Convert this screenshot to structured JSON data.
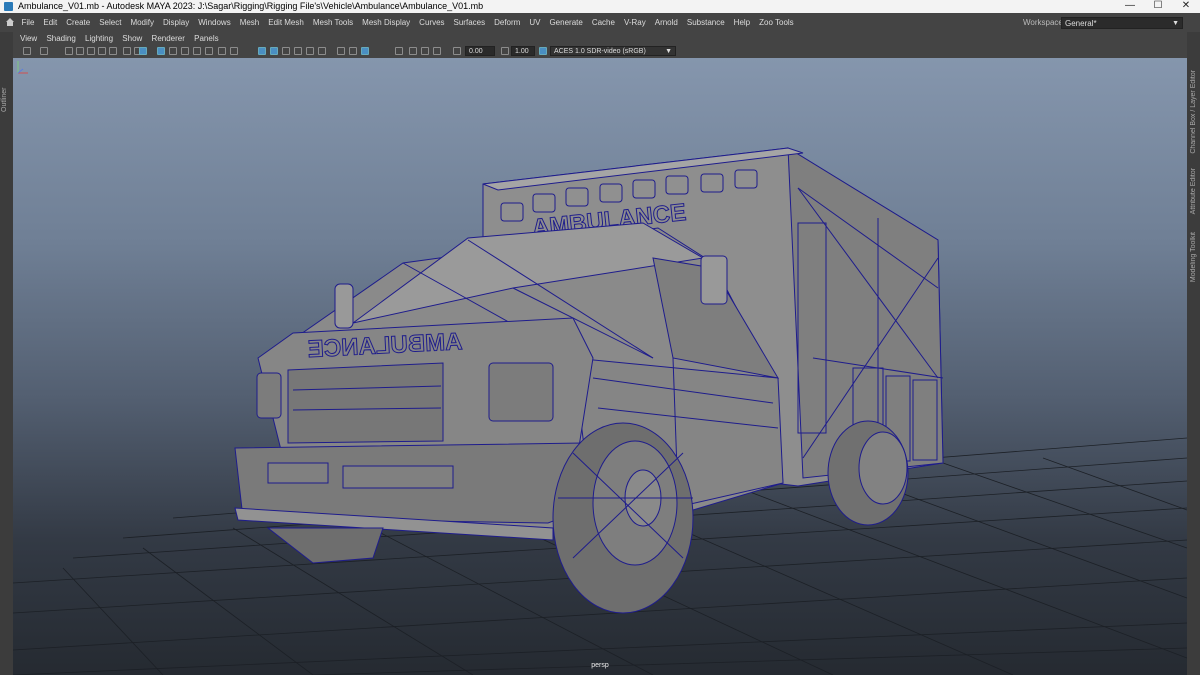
{
  "window": {
    "title": "Ambulance_V01.mb - Autodesk MAYA 2023: J:\\Sagar\\Rigging\\Rigging File's\\Vehicle\\Ambulance\\Ambulance_V01.mb",
    "minimize": "—",
    "maximize": "☐",
    "close": "✕"
  },
  "menubar": {
    "items": [
      "File",
      "Edit",
      "Create",
      "Select",
      "Modify",
      "Display",
      "Windows",
      "Mesh",
      "Edit Mesh",
      "Mesh Tools",
      "Mesh Display",
      "Curves",
      "Surfaces",
      "Deform",
      "UV",
      "Generate",
      "Cache",
      "V-Ray",
      "Arnold",
      "Substance",
      "Help",
      "Zoo Tools"
    ],
    "workspace_label": "Workspace:",
    "workspace_value": "General*"
  },
  "side_panels": {
    "left": "Outliner",
    "right": [
      "Channel Box / Layer Editor",
      "Attribute Editor",
      "Modeling Toolkit"
    ]
  },
  "panel_menu": [
    "View",
    "Shading",
    "Lighting",
    "Show",
    "Renderer",
    "Panels"
  ],
  "toolbar": {
    "field_1": "0.00",
    "field_2": "1.00",
    "color_space": "ACES 1.0 SDR-video (sRGB)"
  },
  "viewport": {
    "camera": "persp",
    "model_text": "AMBULANCE",
    "colors": {
      "wire": "#1e1c8c",
      "mesh": "#8a8a8a",
      "grid": "#1c2026"
    }
  }
}
